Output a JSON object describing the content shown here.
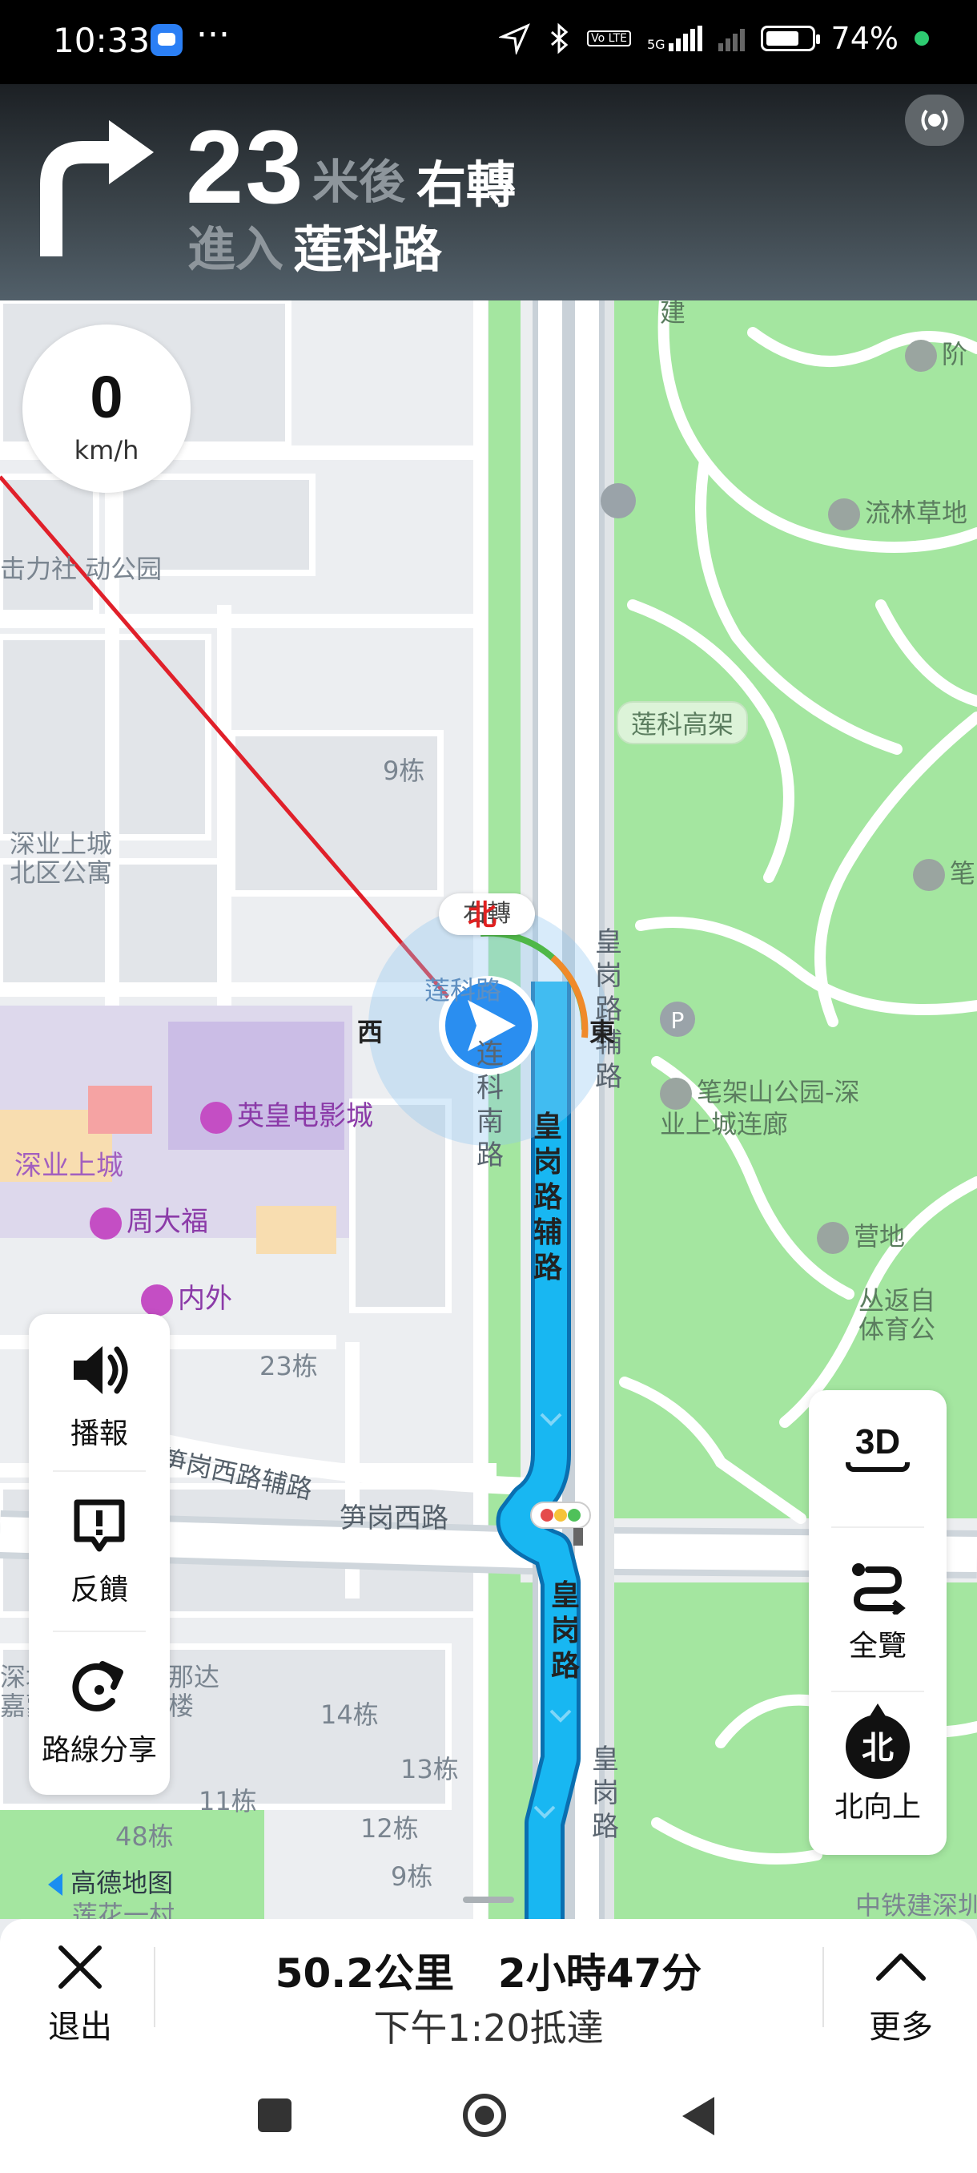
{
  "status_bar": {
    "time": "10:33",
    "ellipsis": "···",
    "network": "5G",
    "volte": "Vo LTE",
    "battery": "74%"
  },
  "navigation": {
    "distance": "23",
    "distance_unit": "米後",
    "action": "右轉",
    "enter_label": "進入",
    "road_name": "莲科路"
  },
  "speed": {
    "value": "0",
    "unit": "km/h"
  },
  "map": {
    "labels": {
      "lianke_viaduct": "莲科高架",
      "building_9": "9栋",
      "shenye_north": "深业上城\n北区公寓",
      "sports_park": "击力社\n动公园",
      "jian": "建",
      "a": "阶",
      "liulin": "流林草地",
      "bijia_a": "笔",
      "huanggang_fu_v": [
        "皇",
        "岗",
        "路",
        "辅",
        "路"
      ],
      "huanggang_fu_right": [
        "皇",
        "岗",
        "路",
        "辅",
        "路"
      ],
      "huanggang_v": [
        "皇",
        "岗",
        "路"
      ],
      "huanggang_right": [
        "皇",
        "岗",
        "路"
      ],
      "lianke_south": [
        "连",
        "科",
        "南",
        "路"
      ],
      "emperor_cinema": "英皇电影城",
      "shenye_upper": "深业上城",
      "zhoudafu": "周大福",
      "neiwai": "内外",
      "building_23": "23栋",
      "bijiashan": "笔架山公园-深\n业上城连廊",
      "camp": "营地",
      "congqian": "丛返自\n体育公",
      "sungang_west_fu": "笋岗西路辅路",
      "sungang_west": "笋岗西路",
      "shen": "深圳\n嘉蒙",
      "nada": "那达\n楼",
      "building_14": "14栋",
      "building_13": "13栋",
      "building_11": "11栋",
      "building_12": "12栋",
      "building_48": "48栋",
      "building_9b": "9栋",
      "lianhua": "莲花一村",
      "zhongtie": "中铁建深圳",
      "amap": "高德地图",
      "west": "西",
      "east": "東",
      "north": "北",
      "right_turn_tag": "右轉",
      "lianke_road_tag": "莲科路"
    }
  },
  "left_panel": {
    "broadcast": "播報",
    "feedback": "反饋",
    "share": "路線分享"
  },
  "right_panel": {
    "view_3d": "3D",
    "overview": "全覽",
    "north_up": "北向上",
    "north_char": "北"
  },
  "bottom_bar": {
    "exit": "退出",
    "distance": "50.2公里",
    "duration": "2小時47分",
    "eta": "下午1:20抵達",
    "more": "更多"
  },
  "colors": {
    "route": "#18b7f2",
    "park": "#9ce39a",
    "road": "#ffffff",
    "header_bg": "#2a3136"
  }
}
